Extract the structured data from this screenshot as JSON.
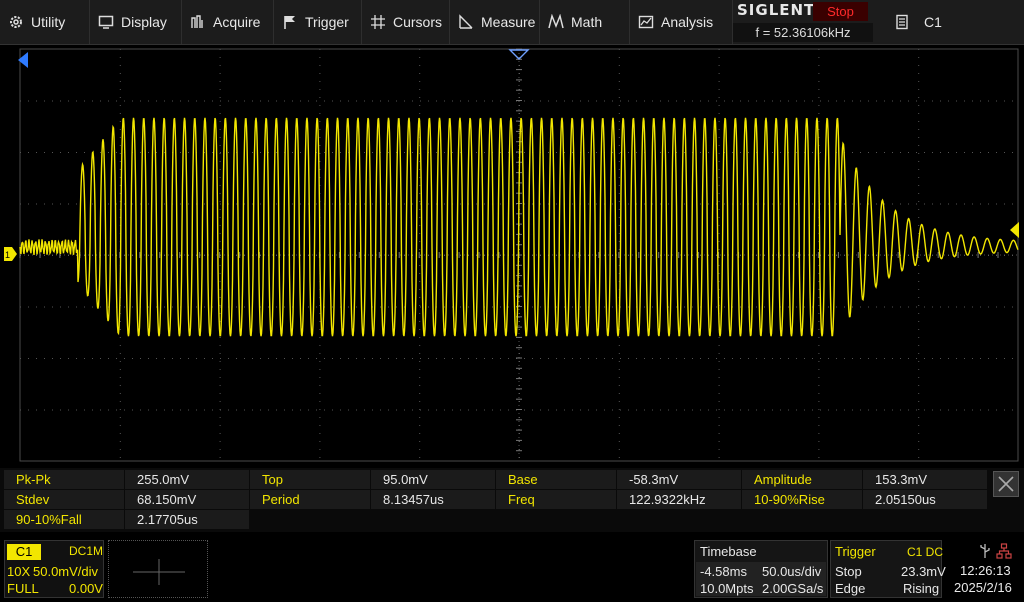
{
  "menu": {
    "utility": "Utility",
    "display": "Display",
    "acquire": "Acquire",
    "trigger": "Trigger",
    "cursors": "Cursors",
    "measure": "Measure",
    "math": "Math",
    "analysis": "Analysis"
  },
  "brand": {
    "logo": "SIGLENT",
    "status": "Stop",
    "frequency": "f = 52.36106kHz"
  },
  "channel_select": "C1",
  "waveform": {
    "channel_color": "#f2e600"
  },
  "measurements": [
    {
      "name": "Pk-Pk",
      "value": "255.0mV"
    },
    {
      "name": "Top",
      "value": "95.0mV"
    },
    {
      "name": "Base",
      "value": "-58.3mV"
    },
    {
      "name": "Amplitude",
      "value": "153.3mV"
    },
    {
      "name": "Stdev",
      "value": "68.150mV"
    },
    {
      "name": "Period",
      "value": "8.13457us"
    },
    {
      "name": "Freq",
      "value": "122.9322kHz"
    },
    {
      "name": "10-90%Rise",
      "value": "2.05150us"
    },
    {
      "name": "90-10%Fall",
      "value": "2.17705us"
    }
  ],
  "channel1": {
    "tag": "C1",
    "coupling": "DC1M",
    "probe": "10X",
    "scale": "50.0mV/div",
    "bandwidth": "FULL",
    "offset": "0.00V"
  },
  "timebase": {
    "title": "Timebase",
    "delay": "-4.58ms",
    "scale": "50.0us/div",
    "memory": "10.0Mpts",
    "sample_rate": "2.00GSa/s"
  },
  "trigger": {
    "title": "Trigger",
    "source": "C1 DC",
    "mode": "Stop",
    "level": "23.3mV",
    "type": "Edge",
    "slope": "Rising"
  },
  "clock": {
    "time": "12:26:13",
    "date": "2025/2/16"
  }
}
